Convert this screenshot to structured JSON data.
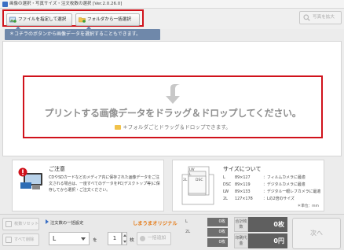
{
  "window": {
    "title": "画像の選択・写真サイズ・注文枚数の選択 [Ver.2.0.26.0]"
  },
  "toolbar": {
    "select_file_label": "ファイルを指定して選択",
    "select_folder_label": "フォルダから一括選択",
    "zoom_label": "写真を拡大"
  },
  "hint": {
    "text": "＊コチラのボタンから画像データを選択することもできます。"
  },
  "dropzone": {
    "main_text": "プリントする画像データをドラッグ＆ドロップしてください。",
    "sub_text": "＊フォルダごとドラッグ＆ドロップできます。"
  },
  "notice": {
    "title": "ご注意",
    "body": "CDやSDカードなどのメディア内に保存された画像データをご注文される場合は、一度すべてのデータをPC(デスクトップ等)に保存してから選択・ご注文ください。"
  },
  "sizes": {
    "title": "サイズについて",
    "diagram_labels": {
      "lw": "LW",
      "l": "L",
      "dsc": "DSC",
      "twol": "2L"
    },
    "rows": [
      {
        "code": "L",
        "dim": "89×127",
        "desc": "：フィルムカメラに最適"
      },
      {
        "code": "DSC",
        "dim": "89×119",
        "desc": "：デジタルカメラに最適"
      },
      {
        "code": "LW",
        "dim": "89×133",
        "desc": "：デジタル一眼レフカメラに最適"
      },
      {
        "code": "2L",
        "dim": "127×178",
        "desc": "：Lの2倍のサイズ"
      }
    ],
    "unit_note": "＊単位：mm"
  },
  "bottom": {
    "reset_label": "枚数リセット",
    "delete_all_label": "すべて削除",
    "bulk_label": "注文数の一括設定",
    "original_label": "しまうまオリジナル",
    "size_value": "L",
    "wo_label": "を",
    "qty_value": "1",
    "mai_label": "枚",
    "add_label": "一括追加"
  },
  "counts": [
    {
      "key": "L",
      "value": "0枚"
    },
    {
      "key": "2L",
      "value": "0枚"
    },
    {
      "key": "",
      "value": "0枚"
    }
  ],
  "totals": {
    "total_label": "合計枚数",
    "total_value": "0枚",
    "print_label": "印刷代金",
    "print_value": "0円"
  },
  "next_label": "次へ",
  "colors": {
    "highlight_red": "#d0121b",
    "hint_blue": "#6f88aa",
    "original_orange": "#e57a16"
  }
}
